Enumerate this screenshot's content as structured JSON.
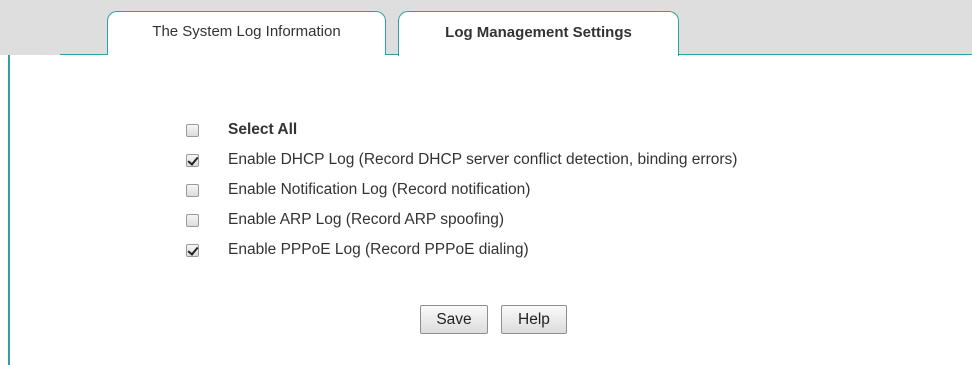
{
  "tabs": [
    {
      "label": "The System Log Information",
      "active": false
    },
    {
      "label": "Log Management Settings",
      "active": true
    }
  ],
  "options": [
    {
      "label": "Select All",
      "checked": false,
      "bold": true
    },
    {
      "label": "Enable DHCP Log (Record DHCP server conflict detection, binding errors)",
      "checked": true
    },
    {
      "label": "Enable Notification Log (Record notification)",
      "checked": false
    },
    {
      "label": "Enable ARP Log (Record ARP spoofing)",
      "checked": false
    },
    {
      "label": "Enable PPPoE Log (Record PPPoE dialing)",
      "checked": true
    }
  ],
  "buttons": {
    "save_label": "Save",
    "help_label": "Help"
  },
  "colors": {
    "accent": "#2f9fa6",
    "tabbar_bg": "#dedede"
  }
}
